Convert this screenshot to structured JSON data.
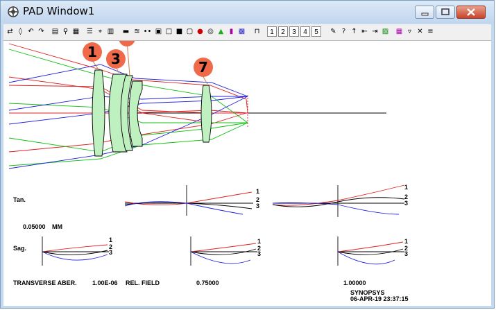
{
  "window": {
    "title": "PAD Window1"
  },
  "toolbar": {
    "field_buttons": [
      "1",
      "2",
      "3",
      "4",
      "5"
    ]
  },
  "markers": [
    "1",
    "3",
    "7"
  ],
  "labels": {
    "tan": "Tan.",
    "sag": "Sag.",
    "scale_value": "0.05000",
    "scale_unit": "MM",
    "transverse": "TRANSVERSE ABER.",
    "wavelength": "1.00E-06",
    "rel_field": "REL. FIELD",
    "field_mid": "0.75000",
    "field_full": "1.00000",
    "brand": "SYNOPSYS",
    "timestamp": "06-APR-19  23:37:15"
  },
  "ray_labels": [
    "1",
    "2",
    "3"
  ],
  "colors": {
    "red": "#e02020",
    "blue": "#2020e0",
    "green": "#10c010",
    "lens_fill": "#bff0bf",
    "marker": "#f06a4a"
  }
}
